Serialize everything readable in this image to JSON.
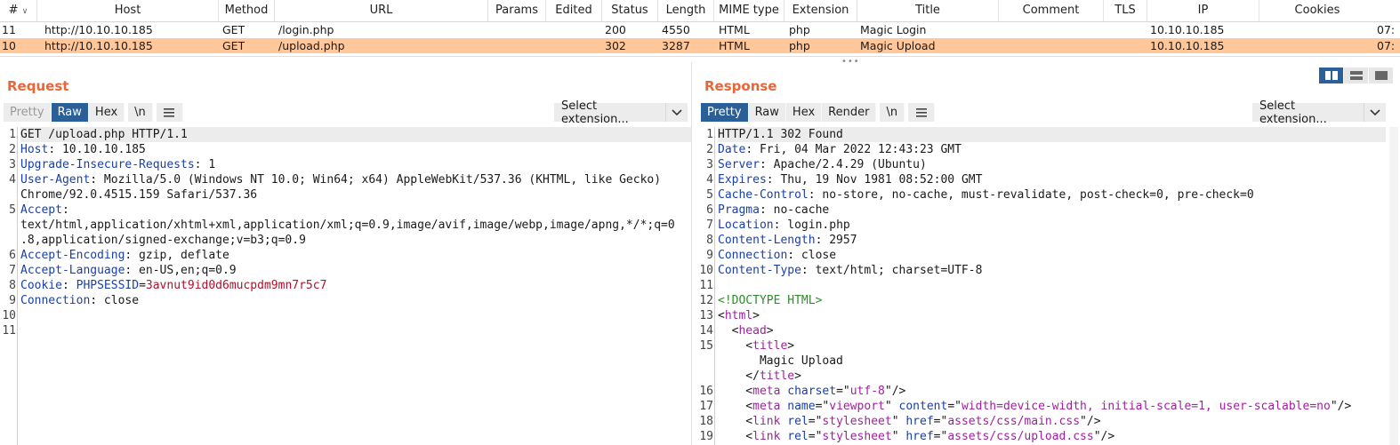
{
  "history": {
    "columns": [
      "#",
      "Host",
      "Method",
      "URL",
      "Params",
      "Edited",
      "Status",
      "Length",
      "MIME type",
      "Extension",
      "Title",
      "Comment",
      "TLS",
      "IP",
      "Cookies"
    ],
    "rows": [
      {
        "num": "11",
        "host": "http://10.10.10.185",
        "method": "GET",
        "url": "/login.php",
        "params": "",
        "edited": "",
        "status": "200",
        "length": "4550",
        "mime": "HTML",
        "ext": "php",
        "title": "Magic Login",
        "comment": "",
        "tls": "",
        "ip": "10.10.10.185",
        "cookies": "",
        "time": "07:"
      },
      {
        "num": "10",
        "host": "http://10.10.10.185",
        "method": "GET",
        "url": "/upload.php",
        "params": "",
        "edited": "",
        "status": "302",
        "length": "3287",
        "mime": "HTML",
        "ext": "php",
        "title": "Magic Upload",
        "comment": "",
        "tls": "",
        "ip": "10.10.10.185",
        "cookies": "",
        "time": "07:"
      }
    ],
    "selected_row": 1,
    "highlight_color": "#ffc79a",
    "splitter_glyph": "•••"
  },
  "request": {
    "title": "Request",
    "tabs": [
      "Pretty",
      "Raw",
      "Hex",
      "\\n"
    ],
    "active_tab": "Raw",
    "select_extension": "Select extension...",
    "line_numbers": [
      "1",
      "2",
      "3",
      "4",
      "",
      "5",
      "",
      "",
      "6",
      "7",
      "8",
      "9",
      "10",
      "11"
    ],
    "lines": [
      {
        "parts": [
          [
            "",
            "GET /upload.php HTTP/1.1"
          ]
        ]
      },
      {
        "parts": [
          [
            "k",
            "Host"
          ],
          [
            "",
            ": 10.10.10.185"
          ]
        ]
      },
      {
        "parts": [
          [
            "k",
            "Upgrade-Insecure-Requests"
          ],
          [
            "",
            ": 1"
          ]
        ]
      },
      {
        "parts": [
          [
            "k",
            "User-Agent"
          ],
          [
            "",
            ": Mozilla/5.0 (Windows NT 10.0; Win64; x64) AppleWebKit/537.36 (KHTML, like Gecko)"
          ]
        ]
      },
      {
        "parts": [
          [
            "",
            "Chrome/92.0.4515.159 Safari/537.36"
          ]
        ]
      },
      {
        "parts": [
          [
            "k",
            "Accept"
          ],
          [
            "",
            ":"
          ]
        ]
      },
      {
        "parts": [
          [
            "",
            "text/html,application/xhtml+xml,application/xml;q=0.9,image/avif,image/webp,image/apng,*/*;q=0"
          ]
        ]
      },
      {
        "parts": [
          [
            "",
            ".8,application/signed-exchange;v=b3;q=0.9"
          ]
        ]
      },
      {
        "parts": [
          [
            "k",
            "Accept-Encoding"
          ],
          [
            "",
            ": gzip, deflate"
          ]
        ]
      },
      {
        "parts": [
          [
            "k",
            "Accept-Language"
          ],
          [
            "",
            ": en-US,en;q=0.9"
          ]
        ]
      },
      {
        "parts": [
          [
            "k",
            "Cookie"
          ],
          [
            "",
            ": "
          ],
          [
            "k",
            "PHPSESSID"
          ],
          [
            "",
            "="
          ],
          [
            "v",
            "3avnut9id0d6mucpdm9mn7r5c7"
          ]
        ]
      },
      {
        "parts": [
          [
            "k",
            "Connection"
          ],
          [
            "",
            ": close"
          ]
        ]
      },
      {
        "parts": [
          [
            "",
            ""
          ]
        ]
      },
      {
        "parts": [
          [
            "",
            ""
          ]
        ]
      }
    ]
  },
  "response": {
    "title": "Response",
    "tabs": [
      "Pretty",
      "Raw",
      "Hex",
      "Render",
      "\\n"
    ],
    "active_tab": "Pretty",
    "select_extension": "Select extension...",
    "line_numbers": [
      "1",
      "2",
      "3",
      "4",
      "5",
      "6",
      "7",
      "8",
      "9",
      "10",
      "11",
      "12",
      "13",
      "14",
      "15",
      "",
      "",
      "16",
      "17",
      "18",
      "19"
    ],
    "lines": [
      {
        "parts": [
          [
            "",
            "HTTP/1.1 302 Found"
          ]
        ]
      },
      {
        "parts": [
          [
            "k",
            "Date"
          ],
          [
            "",
            ": Fri, 04 Mar 2022 12:43:23 GMT"
          ]
        ]
      },
      {
        "parts": [
          [
            "k",
            "Server"
          ],
          [
            "",
            ": Apache/2.4.29 (Ubuntu)"
          ]
        ]
      },
      {
        "parts": [
          [
            "k",
            "Expires"
          ],
          [
            "",
            ": Thu, 19 Nov 1981 08:52:00 GMT"
          ]
        ]
      },
      {
        "parts": [
          [
            "k",
            "Cache-Control"
          ],
          [
            "",
            ": no-store, no-cache, must-revalidate, post-check=0, pre-check=0"
          ]
        ]
      },
      {
        "parts": [
          [
            "k",
            "Pragma"
          ],
          [
            "",
            ": no-cache"
          ]
        ]
      },
      {
        "parts": [
          [
            "k",
            "Location"
          ],
          [
            "",
            ": login.php"
          ]
        ]
      },
      {
        "parts": [
          [
            "k",
            "Content-Length"
          ],
          [
            "",
            ": 2957"
          ]
        ]
      },
      {
        "parts": [
          [
            "k",
            "Connection"
          ],
          [
            "",
            ": close"
          ]
        ]
      },
      {
        "parts": [
          [
            "k",
            "Content-Type"
          ],
          [
            "",
            ": text/html; charset=UTF-8"
          ]
        ]
      },
      {
        "parts": [
          [
            "",
            ""
          ]
        ]
      },
      {
        "parts": [
          [
            "doc",
            "<!DOCTYPE HTML>"
          ]
        ]
      },
      {
        "parts": [
          [
            "",
            "<"
          ],
          [
            "tag",
            "html"
          ],
          [
            "",
            ">"
          ]
        ]
      },
      {
        "parts": [
          [
            "",
            "  <"
          ],
          [
            "tag",
            "head"
          ],
          [
            "",
            ">"
          ]
        ]
      },
      {
        "parts": [
          [
            "",
            "    <"
          ],
          [
            "tag",
            "title"
          ],
          [
            "",
            ">"
          ]
        ]
      },
      {
        "parts": [
          [
            "",
            "      Magic Upload"
          ]
        ]
      },
      {
        "parts": [
          [
            "",
            "    </"
          ],
          [
            "tag",
            "title"
          ],
          [
            "",
            ">"
          ]
        ]
      },
      {
        "parts": [
          [
            "",
            "    <"
          ],
          [
            "tag",
            "meta"
          ],
          [
            "",
            " "
          ],
          [
            "attr",
            "charset"
          ],
          [
            "",
            "=\""
          ],
          [
            "str",
            "utf-8"
          ],
          [
            "",
            "\"/>"
          ]
        ]
      },
      {
        "parts": [
          [
            "",
            "    <"
          ],
          [
            "tag",
            "meta"
          ],
          [
            "",
            " "
          ],
          [
            "attr",
            "name"
          ],
          [
            "",
            "=\""
          ],
          [
            "str",
            "viewport"
          ],
          [
            "",
            "\" "
          ],
          [
            "attr",
            "content"
          ],
          [
            "",
            "=\""
          ],
          [
            "str",
            "width=device-width, initial-scale=1, user-scalable=no"
          ],
          [
            "",
            "\"/>"
          ]
        ]
      },
      {
        "parts": [
          [
            "",
            "    <"
          ],
          [
            "tag",
            "link"
          ],
          [
            "",
            " "
          ],
          [
            "attr",
            "rel"
          ],
          [
            "",
            "=\""
          ],
          [
            "str",
            "stylesheet"
          ],
          [
            "",
            "\" "
          ],
          [
            "attr",
            "href"
          ],
          [
            "",
            "=\""
          ],
          [
            "str",
            "assets/css/main.css"
          ],
          [
            "",
            "\"/>"
          ]
        ]
      },
      {
        "parts": [
          [
            "",
            "    <"
          ],
          [
            "tag",
            "link"
          ],
          [
            "",
            " "
          ],
          [
            "attr",
            "rel"
          ],
          [
            "",
            "=\""
          ],
          [
            "str",
            "stylesheet"
          ],
          [
            "",
            "\" "
          ],
          [
            "attr",
            "href"
          ],
          [
            "",
            "=\""
          ],
          [
            "str",
            "assets/css/upload.css"
          ],
          [
            "",
            "\"/>"
          ]
        ]
      }
    ]
  },
  "icons": {
    "menu": "hamburger-icon",
    "dropdown": "chevron-down-icon",
    "sort": "sort-chevron-icon",
    "layout": [
      "split-horizontal-icon",
      "split-vertical-icon",
      "single-tab-icon"
    ]
  },
  "colors": {
    "accent": "#e8673a",
    "active_tab": "#2a5f97",
    "header_key": "#1a3fa8",
    "cookie_value": "#b0102a",
    "tag": "#a020a0",
    "doctype": "#2e8b2e"
  }
}
